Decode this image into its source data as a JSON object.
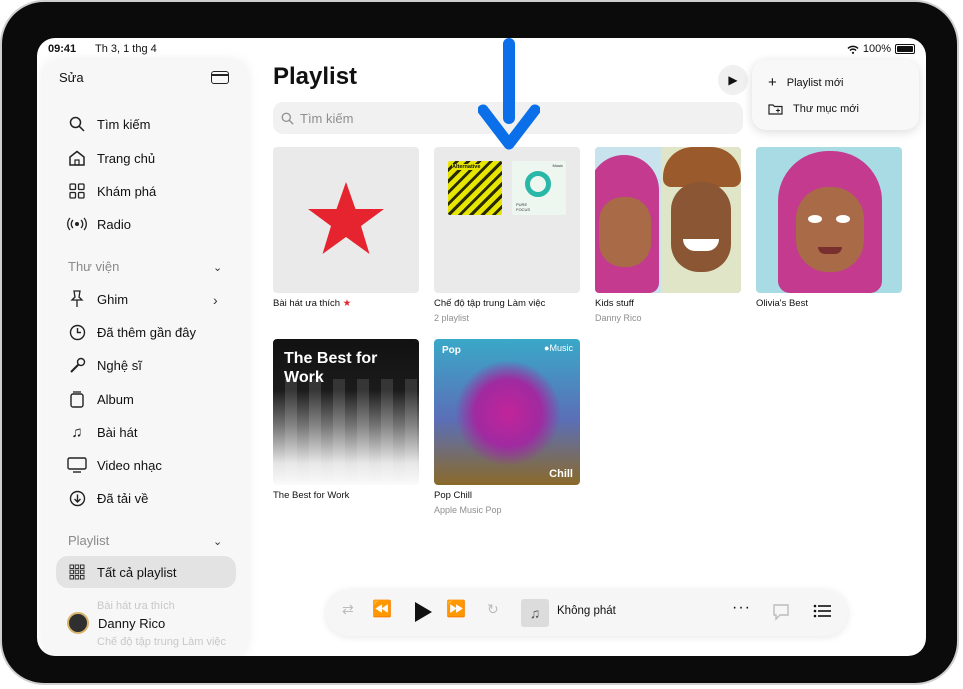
{
  "status": {
    "time": "09:41",
    "date": "Th 3, 1 thg 4",
    "battery": "100%"
  },
  "sidebar": {
    "edit_label": "Sửa",
    "nav": [
      {
        "label": "Tìm kiếm",
        "icon": "search-icon"
      },
      {
        "label": "Trang chủ",
        "icon": "home-icon"
      },
      {
        "label": "Khám phá",
        "icon": "grid-icon"
      },
      {
        "label": "Radio",
        "icon": "radio-icon"
      }
    ],
    "library_heading": "Thư viện",
    "library": [
      {
        "label": "Ghim",
        "icon": "pin-icon"
      },
      {
        "label": "Đã thêm gần đây",
        "icon": "clock-icon"
      },
      {
        "label": "Nghệ sĩ",
        "icon": "microphone-icon"
      },
      {
        "label": "Album",
        "icon": "album-icon"
      },
      {
        "label": "Bài hát",
        "icon": "music-note-icon"
      },
      {
        "label": "Video nhạc",
        "icon": "tv-icon"
      },
      {
        "label": "Đã tải về",
        "icon": "download-icon"
      }
    ],
    "playlist_heading": "Playlist",
    "all_playlists": "Tất cả playlist",
    "faded_items": [
      "Bài hát ưa thích",
      "Chế độ tập trung Làm việc"
    ],
    "user_name": "Danny Rico"
  },
  "main": {
    "title": "Playlist",
    "search_placeholder": "Tìm kiếm",
    "menu": [
      {
        "label": "Playlist mới",
        "icon": "plus-icon"
      },
      {
        "label": "Thư mục mới",
        "icon": "folder-plus-icon"
      }
    ],
    "playlists": [
      {
        "title": "Bài hát ưa thích",
        "subtitle": ""
      },
      {
        "title": "Chế độ tập trung Làm việc",
        "subtitle": "2 playlist"
      },
      {
        "title": "Kids stuff",
        "subtitle": "Danny Rico"
      },
      {
        "title": "Olivia's Best",
        "subtitle": ""
      },
      {
        "title": "The Best for Work",
        "subtitle": ""
      },
      {
        "title": "Pop Chill",
        "subtitle": "Apple Music Pop"
      }
    ],
    "artwork_text": {
      "alternative": "Alternative",
      "pure_focus": "PURE FOCUS",
      "music_small": "Music",
      "best_for_work": "The Best for Work",
      "pop": "Pop",
      "apple_music": "Music",
      "chill": "Chill"
    }
  },
  "player": {
    "now_playing": "Không phát"
  },
  "colors": {
    "accent_red": "#e5242f",
    "arrow_blue": "#0a6fe8"
  }
}
